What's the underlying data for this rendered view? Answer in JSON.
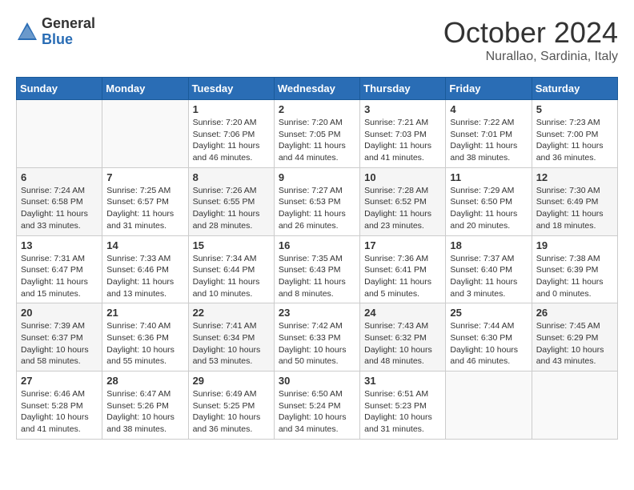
{
  "logo": {
    "general": "General",
    "blue": "Blue"
  },
  "title": "October 2024",
  "subtitle": "Nurallao, Sardinia, Italy",
  "days_of_week": [
    "Sunday",
    "Monday",
    "Tuesday",
    "Wednesday",
    "Thursday",
    "Friday",
    "Saturday"
  ],
  "weeks": [
    [
      {
        "day": "",
        "info": ""
      },
      {
        "day": "",
        "info": ""
      },
      {
        "day": "1",
        "info": "Sunrise: 7:20 AM\nSunset: 7:06 PM\nDaylight: 11 hours and 46 minutes."
      },
      {
        "day": "2",
        "info": "Sunrise: 7:20 AM\nSunset: 7:05 PM\nDaylight: 11 hours and 44 minutes."
      },
      {
        "day": "3",
        "info": "Sunrise: 7:21 AM\nSunset: 7:03 PM\nDaylight: 11 hours and 41 minutes."
      },
      {
        "day": "4",
        "info": "Sunrise: 7:22 AM\nSunset: 7:01 PM\nDaylight: 11 hours and 38 minutes."
      },
      {
        "day": "5",
        "info": "Sunrise: 7:23 AM\nSunset: 7:00 PM\nDaylight: 11 hours and 36 minutes."
      }
    ],
    [
      {
        "day": "6",
        "info": "Sunrise: 7:24 AM\nSunset: 6:58 PM\nDaylight: 11 hours and 33 minutes."
      },
      {
        "day": "7",
        "info": "Sunrise: 7:25 AM\nSunset: 6:57 PM\nDaylight: 11 hours and 31 minutes."
      },
      {
        "day": "8",
        "info": "Sunrise: 7:26 AM\nSunset: 6:55 PM\nDaylight: 11 hours and 28 minutes."
      },
      {
        "day": "9",
        "info": "Sunrise: 7:27 AM\nSunset: 6:53 PM\nDaylight: 11 hours and 26 minutes."
      },
      {
        "day": "10",
        "info": "Sunrise: 7:28 AM\nSunset: 6:52 PM\nDaylight: 11 hours and 23 minutes."
      },
      {
        "day": "11",
        "info": "Sunrise: 7:29 AM\nSunset: 6:50 PM\nDaylight: 11 hours and 20 minutes."
      },
      {
        "day": "12",
        "info": "Sunrise: 7:30 AM\nSunset: 6:49 PM\nDaylight: 11 hours and 18 minutes."
      }
    ],
    [
      {
        "day": "13",
        "info": "Sunrise: 7:31 AM\nSunset: 6:47 PM\nDaylight: 11 hours and 15 minutes."
      },
      {
        "day": "14",
        "info": "Sunrise: 7:33 AM\nSunset: 6:46 PM\nDaylight: 11 hours and 13 minutes."
      },
      {
        "day": "15",
        "info": "Sunrise: 7:34 AM\nSunset: 6:44 PM\nDaylight: 11 hours and 10 minutes."
      },
      {
        "day": "16",
        "info": "Sunrise: 7:35 AM\nSunset: 6:43 PM\nDaylight: 11 hours and 8 minutes."
      },
      {
        "day": "17",
        "info": "Sunrise: 7:36 AM\nSunset: 6:41 PM\nDaylight: 11 hours and 5 minutes."
      },
      {
        "day": "18",
        "info": "Sunrise: 7:37 AM\nSunset: 6:40 PM\nDaylight: 11 hours and 3 minutes."
      },
      {
        "day": "19",
        "info": "Sunrise: 7:38 AM\nSunset: 6:39 PM\nDaylight: 11 hours and 0 minutes."
      }
    ],
    [
      {
        "day": "20",
        "info": "Sunrise: 7:39 AM\nSunset: 6:37 PM\nDaylight: 10 hours and 58 minutes."
      },
      {
        "day": "21",
        "info": "Sunrise: 7:40 AM\nSunset: 6:36 PM\nDaylight: 10 hours and 55 minutes."
      },
      {
        "day": "22",
        "info": "Sunrise: 7:41 AM\nSunset: 6:34 PM\nDaylight: 10 hours and 53 minutes."
      },
      {
        "day": "23",
        "info": "Sunrise: 7:42 AM\nSunset: 6:33 PM\nDaylight: 10 hours and 50 minutes."
      },
      {
        "day": "24",
        "info": "Sunrise: 7:43 AM\nSunset: 6:32 PM\nDaylight: 10 hours and 48 minutes."
      },
      {
        "day": "25",
        "info": "Sunrise: 7:44 AM\nSunset: 6:30 PM\nDaylight: 10 hours and 46 minutes."
      },
      {
        "day": "26",
        "info": "Sunrise: 7:45 AM\nSunset: 6:29 PM\nDaylight: 10 hours and 43 minutes."
      }
    ],
    [
      {
        "day": "27",
        "info": "Sunrise: 6:46 AM\nSunset: 5:28 PM\nDaylight: 10 hours and 41 minutes."
      },
      {
        "day": "28",
        "info": "Sunrise: 6:47 AM\nSunset: 5:26 PM\nDaylight: 10 hours and 38 minutes."
      },
      {
        "day": "29",
        "info": "Sunrise: 6:49 AM\nSunset: 5:25 PM\nDaylight: 10 hours and 36 minutes."
      },
      {
        "day": "30",
        "info": "Sunrise: 6:50 AM\nSunset: 5:24 PM\nDaylight: 10 hours and 34 minutes."
      },
      {
        "day": "31",
        "info": "Sunrise: 6:51 AM\nSunset: 5:23 PM\nDaylight: 10 hours and 31 minutes."
      },
      {
        "day": "",
        "info": ""
      },
      {
        "day": "",
        "info": ""
      }
    ]
  ]
}
